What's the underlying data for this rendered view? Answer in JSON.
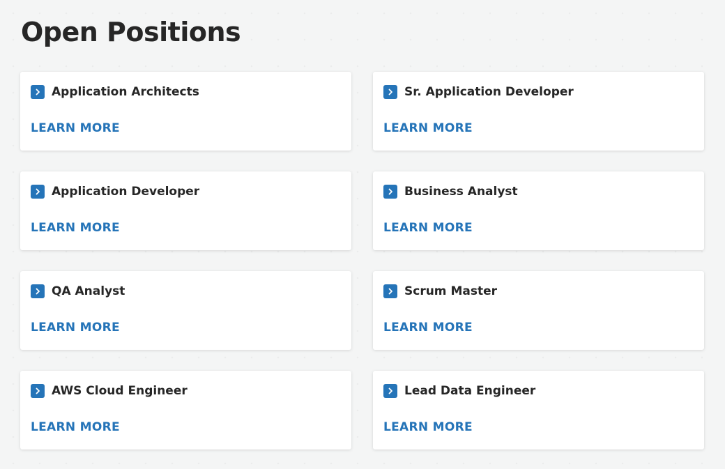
{
  "page": {
    "title": "Open Positions"
  },
  "colors": {
    "accent": "#2574b8",
    "text": "#262626",
    "background": "#f4f5f5",
    "card": "#ffffff"
  },
  "positions": [
    {
      "title": "Application Architects",
      "link_label": "LEARN MORE",
      "icon": "chevron-right-icon"
    },
    {
      "title": "Sr. Application Developer",
      "link_label": "LEARN MORE",
      "icon": "chevron-right-icon"
    },
    {
      "title": "Application Developer",
      "link_label": "LEARN MORE",
      "icon": "chevron-right-icon"
    },
    {
      "title": "Business Analyst",
      "link_label": "LEARN MORE",
      "icon": "chevron-right-icon"
    },
    {
      "title": "QA Analyst",
      "link_label": "LEARN MORE",
      "icon": "chevron-right-icon"
    },
    {
      "title": "Scrum Master",
      "link_label": "LEARN MORE",
      "icon": "chevron-right-icon"
    },
    {
      "title": "AWS Cloud Engineer",
      "link_label": "LEARN MORE",
      "icon": "chevron-right-icon"
    },
    {
      "title": "Lead Data Engineer",
      "link_label": "LEARN MORE",
      "icon": "chevron-right-icon"
    }
  ]
}
